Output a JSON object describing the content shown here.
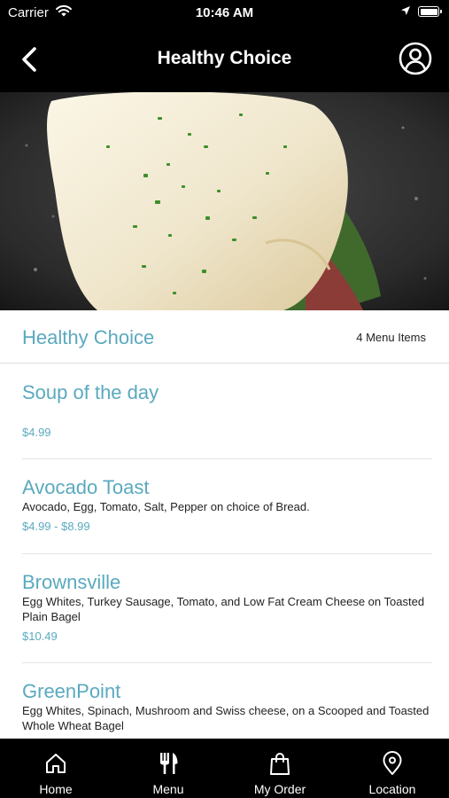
{
  "status_bar": {
    "carrier": "Carrier",
    "time": "10:46 AM"
  },
  "nav": {
    "title": "Healthy Choice",
    "back_icon": "chevron-left-icon",
    "profile_icon": "user-circle-icon"
  },
  "hero": {
    "image": "egg-white-omelette-photo"
  },
  "section": {
    "title": "Healthy Choice",
    "count": "4 Menu Items"
  },
  "items": [
    {
      "name": "Soup of the day",
      "description": "",
      "price": "$4.99"
    },
    {
      "name": "Avocado Toast",
      "description": "Avocado, Egg, Tomato, Salt, Pepper on choice of Bread.",
      "price": "$4.99 - $8.99"
    },
    {
      "name": "Brownsville",
      "description": "Egg Whites, Turkey Sausage, Tomato, and Low Fat Cream Cheese on Toasted Plain Bagel",
      "price": "$10.49"
    },
    {
      "name": "GreenPoint",
      "description": "Egg Whites, Spinach, Mushroom and Swiss cheese, on a Scooped and Toasted Whole Wheat Bagel",
      "price": ""
    }
  ],
  "tabs": [
    {
      "label": "Home",
      "icon": "home-icon"
    },
    {
      "label": "Menu",
      "icon": "fork-knife-icon"
    },
    {
      "label": "My Order",
      "icon": "shopping-bag-icon"
    },
    {
      "label": "Location",
      "icon": "map-pin-icon"
    }
  ],
  "colors": {
    "accent": "#5aa9bf",
    "bar_background": "#000000",
    "text": "#222222"
  }
}
